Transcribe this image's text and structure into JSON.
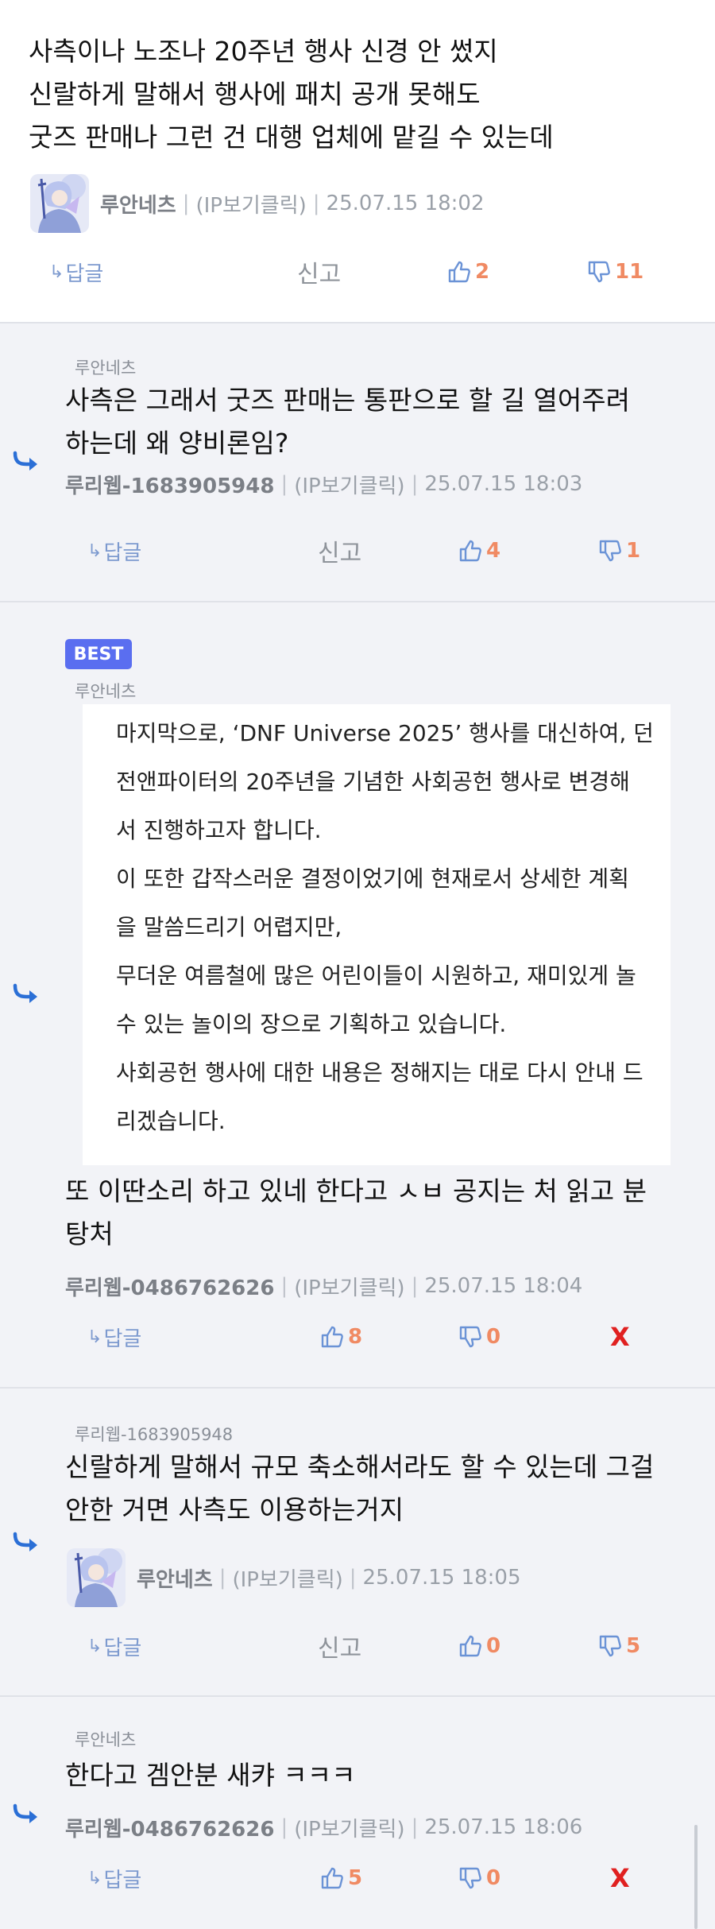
{
  "comments": [
    {
      "text": "사측이나 노조나 20주년 행사 신경 안 썼지\n신랄하게 말해서 행사에 패치 공개 못해도\n굿즈 판매나 그런 건 대행 업체에 맡길 수 있는데",
      "author": "루안네츠",
      "ip": "(IP보기클릭)",
      "time": "25.07.15 18:02",
      "reply_label": "답글",
      "report_label": "신고",
      "up": "2",
      "down": "11"
    },
    {
      "parent": "루안네츠",
      "text": "사측은 그래서 굿즈 판매는 통판으로 할 길 열어주려\n하는데 왜 양비론임?",
      "author": "루리웹-1683905948",
      "ip": "(IP보기클릭)",
      "time": "25.07.15 18:03",
      "reply_label": "답글",
      "report_label": "신고",
      "up": "4",
      "down": "1"
    },
    {
      "badge": "BEST",
      "parent": "루안네츠",
      "quote_lines": [
        "마지막으로, ‘DNF Universe 2025’ 행사를 대신하여, 던",
        "전앤파이터의 20주년을 기념한 사회공헌 행사로 변경해",
        "서 진행하고자 합니다.",
        "이 또한 갑작스러운 결정이었기에 현재로서 상세한 계획",
        "을 말씀드리기 어렵지만,",
        "무더운 여름철에 많은 어린이들이 시원하고, 재미있게 놀",
        "수 있는 놀이의 장으로 기획하고 있습니다.",
        "사회공헌 행사에 대한 내용은 정해지는 대로 다시 안내 드",
        "리겠습니다."
      ],
      "text": "또 이딴소리 하고 있네 한다고 ㅅㅂ 공지는 처 읽고 분\n탕처",
      "author": "루리웹-0486762626",
      "ip": "(IP보기클릭)",
      "time": "25.07.15 18:04",
      "reply_label": "답글",
      "up": "8",
      "down": "0",
      "delete_label": "X"
    },
    {
      "parent": "루리웹-1683905948",
      "text": "신랄하게 말해서 규모 축소해서라도 할 수 있는데 그걸\n안한 거면 사측도 이용하는거지",
      "author": "루안네츠",
      "ip": "(IP보기클릭)",
      "time": "25.07.15 18:05",
      "reply_label": "답글",
      "report_label": "신고",
      "up": "0",
      "down": "5"
    },
    {
      "parent": "루안네츠",
      "text": "한다고 겜안분 새캬 ㅋㅋㅋ",
      "author": "루리웹-0486762626",
      "ip": "(IP보기클릭)",
      "time": "25.07.15 18:06",
      "reply_label": "답글",
      "up": "5",
      "down": "0",
      "delete_label": "X"
    }
  ],
  "colors": {
    "reply_arrow": "#2b6fd6",
    "vote_count": "#f08a63",
    "thumb_icon": "#6b93d6",
    "best_badge": "#5a6ef0",
    "delete": "#e02020"
  },
  "icons": {
    "reply_arrow": "reply-arrow-icon",
    "reply_button": "return-arrow-icon",
    "upvote": "thumbs-up-icon",
    "downvote": "thumbs-down-icon",
    "avatar": "anime-character-avatar"
  }
}
